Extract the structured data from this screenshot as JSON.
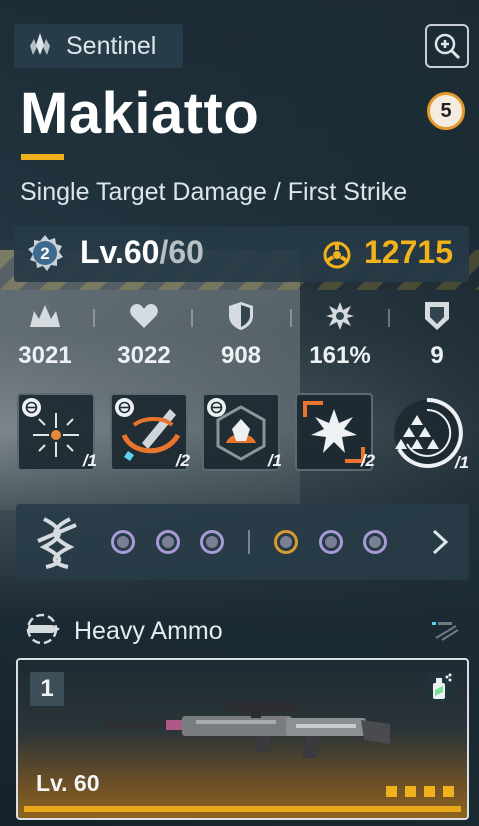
{
  "character": {
    "class_label": "Sentinel",
    "class_icon": "sentinel-class-icon",
    "name": "Makiatto",
    "rank": "5",
    "role": "Single Target Damage / First Strike"
  },
  "level": {
    "emblem_number": "2",
    "current": "Lv.60",
    "separator": "/",
    "max": "60",
    "power": "12715"
  },
  "stats": [
    {
      "icon": "attack-icon",
      "value": "3021"
    },
    {
      "icon": "health-icon",
      "value": "3022"
    },
    {
      "icon": "defense-icon",
      "value": "908"
    },
    {
      "icon": "crit-icon",
      "value": "161%"
    },
    {
      "icon": "stability-icon",
      "value": "9"
    }
  ],
  "skills": [
    {
      "icon": "crosshair-skill-icon",
      "count": "/1"
    },
    {
      "icon": "bullet-swirl-skill-icon",
      "count": "/2"
    },
    {
      "icon": "crystal-hex-skill-icon",
      "count": "/1"
    },
    {
      "icon": "star-burst-skill-icon",
      "count": "/2"
    },
    {
      "icon": "ultimate-triangles-icon",
      "count": "/1"
    }
  ],
  "mods": {
    "icon": "neural-helix-icon",
    "slots": [
      "purple",
      "purple",
      "purple",
      "gold",
      "purple",
      "purple"
    ]
  },
  "weapon": {
    "ammo_type": "Heavy Ammo",
    "slot_number": "1",
    "level": "Lv. 60",
    "rarity_pips": 4
  },
  "colors": {
    "accent": "#f0b21c",
    "power": "#f4b21a",
    "mod_purple": "#a89ad4",
    "mod_gold": "#d89a31"
  }
}
